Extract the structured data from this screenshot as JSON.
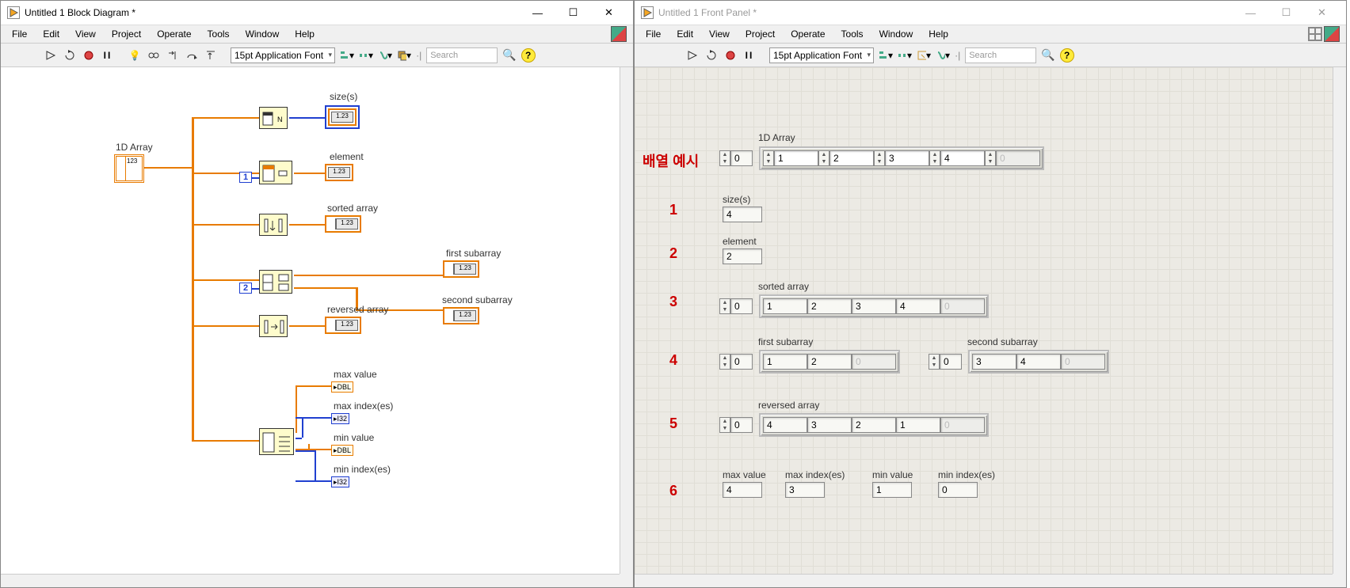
{
  "windows": {
    "block": {
      "title": "Untitled 1 Block Diagram *"
    },
    "front": {
      "title": "Untitled 1 Front Panel *"
    }
  },
  "menu": {
    "file": "File",
    "edit": "Edit",
    "view": "View",
    "project": "Project",
    "operate": "Operate",
    "tools": "Tools",
    "window": "Window",
    "help": "Help"
  },
  "toolbar": {
    "font": "15pt Application Font",
    "search_placeholder": "Search"
  },
  "bd": {
    "labels": {
      "array1d": "1D Array",
      "sizes": "size(s)",
      "element": "element",
      "sorted": "sorted array",
      "first_sub": "first subarray",
      "second_sub": "second subarray",
      "reversed": "reversed array",
      "max_val": "max value",
      "max_idx": "max index(es)",
      "min_val": "min value",
      "min_idx": "min index(es)"
    },
    "consts": {
      "one": "1",
      "two": "2"
    },
    "ind_num": "1.23",
    "dbl": "DBL",
    "i32": "I32"
  },
  "fp": {
    "annot": {
      "example": "배열 예시",
      "n1": "1",
      "n2": "2",
      "n3": "3",
      "n4": "4",
      "n5": "5",
      "n6": "6"
    },
    "labels": {
      "array1d": "1D Array",
      "sizes": "size(s)",
      "element": "element",
      "sorted": "sorted array",
      "first_sub": "first subarray",
      "second_sub": "second subarray",
      "reversed": "reversed array",
      "max_val": "max value",
      "max_idx": "max index(es)",
      "min_val": "min value",
      "min_idx": "min index(es)"
    },
    "idx0": "0",
    "array_in": [
      "1",
      "2",
      "3",
      "4",
      "0"
    ],
    "sizes_val": "4",
    "element_val": "2",
    "sorted_vals": [
      "1",
      "2",
      "3",
      "4",
      "0"
    ],
    "first_vals": [
      "1",
      "2",
      "0"
    ],
    "second_vals": [
      "3",
      "4",
      "0"
    ],
    "reversed_vals": [
      "4",
      "3",
      "2",
      "1",
      "0"
    ],
    "max_val": "4",
    "max_idx": "3",
    "min_val": "1",
    "min_idx": "0"
  }
}
